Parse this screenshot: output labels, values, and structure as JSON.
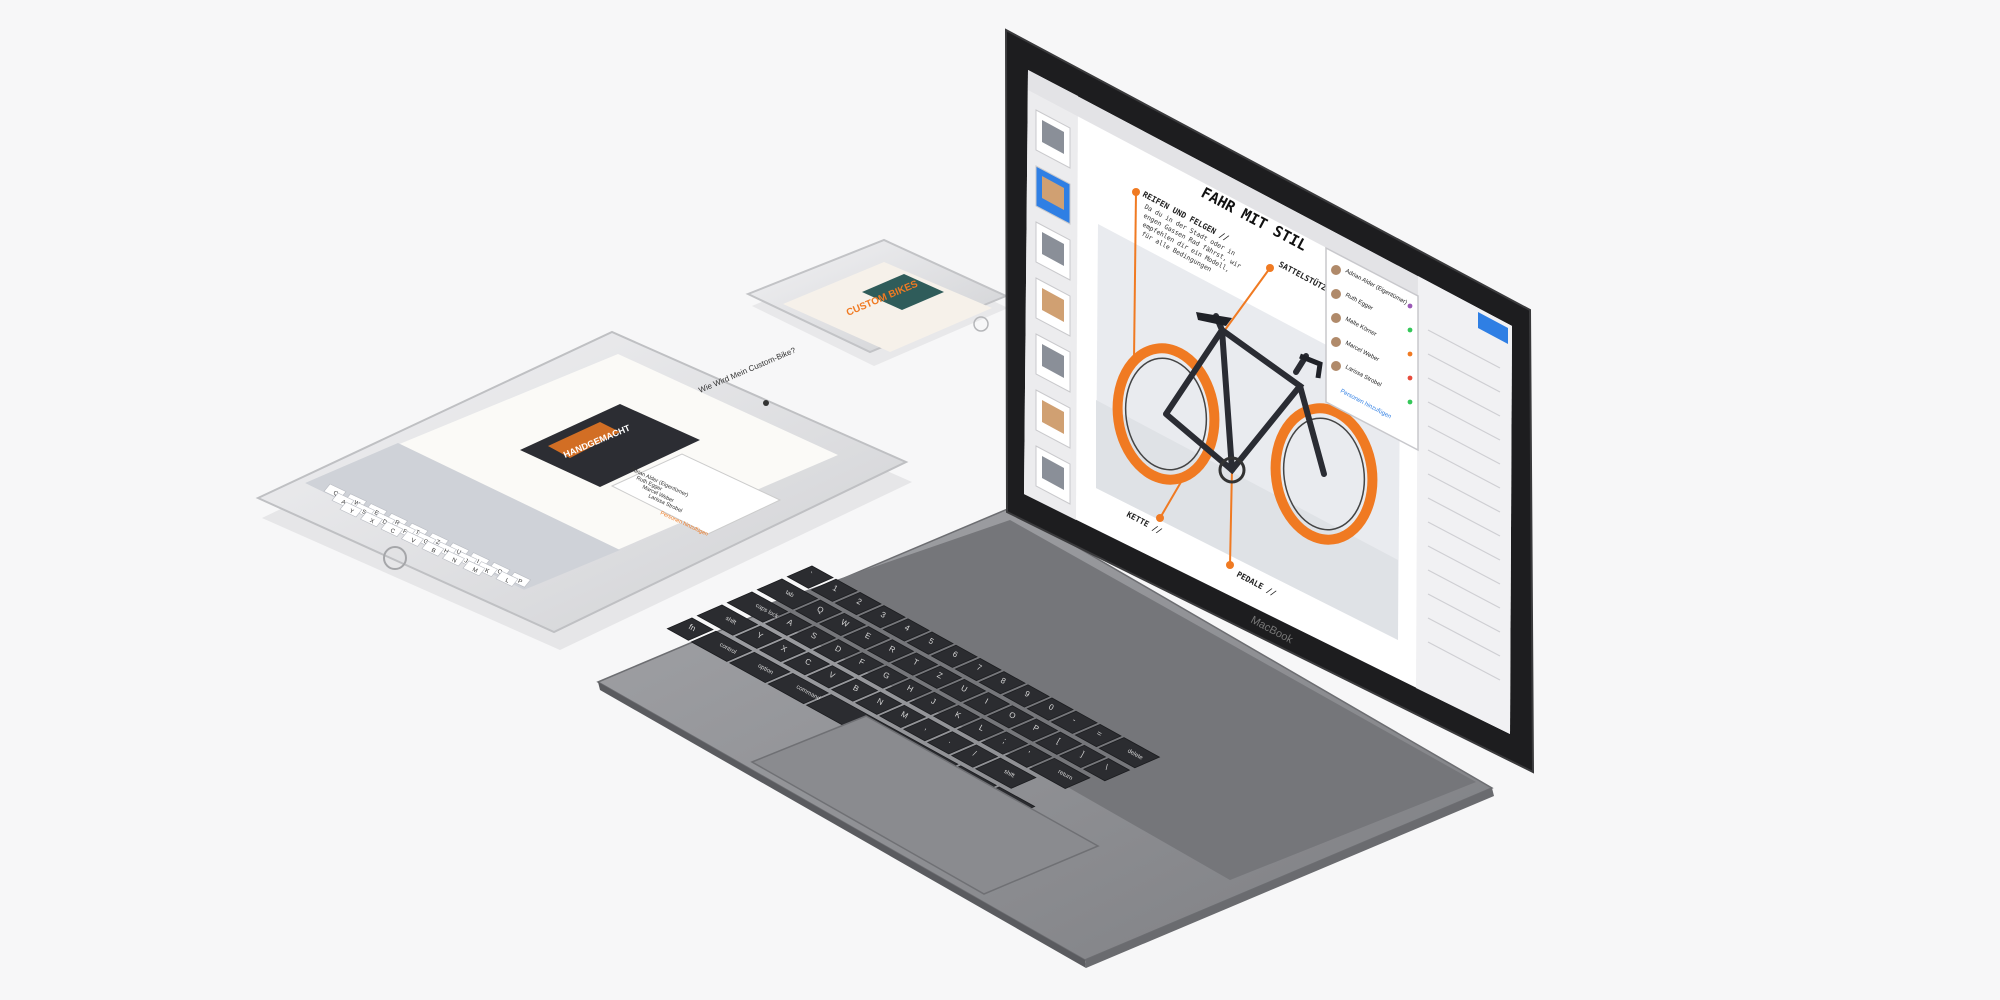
{
  "colors": {
    "background": "#f7f7f8",
    "accent_orange": "#f07a22",
    "macbook_body": "#8e8f93",
    "key_dark": "#2b2c30",
    "bezel": "#1a1a1c",
    "device_silver": "#e4e5e8",
    "collab_green": "#35c759",
    "selection_blue": "#2f7fe4"
  },
  "macbook": {
    "brand": "MacBook",
    "doc": {
      "title": "FAHR MIT STIL",
      "callouts": {
        "tires": "REIFEN UND FELGEN //",
        "saddle": "SATTELSTÜTZE",
        "chain": "KETTE //",
        "pedals": "PEDALE //"
      },
      "body_lines": [
        "Da du in der Stadt oder in",
        "engen Gassen Rad fährst, wir",
        "empfehlen dir ein Modell,",
        "für alle Bedingungen"
      ]
    },
    "collab_popover": {
      "items": [
        "Adrian Alder (Eigentümer)",
        "Ruth Egger",
        "Malte Körner",
        "Marcel Weber",
        "Larissa Strobel"
      ],
      "add_label": "Personen hinzufügen"
    },
    "keyboard": {
      "row1": [
        "`",
        "1",
        "2",
        "3",
        "4",
        "5",
        "6",
        "7",
        "8",
        "9",
        "0",
        "-",
        "=",
        "delete"
      ],
      "row2": [
        "tab",
        "Q",
        "W",
        "E",
        "R",
        "T",
        "Z",
        "U",
        "I",
        "O",
        "P",
        "[",
        "]",
        "\\"
      ],
      "row3": [
        "caps lock",
        "A",
        "S",
        "D",
        "F",
        "G",
        "H",
        "J",
        "K",
        "L",
        ";",
        "'",
        "return"
      ],
      "row4": [
        "shift",
        "Y",
        "X",
        "C",
        "V",
        "B",
        "N",
        "M",
        ",",
        ".",
        "/",
        "shift"
      ],
      "row5": [
        "fn",
        "control",
        "option",
        "command",
        "",
        "command",
        "option"
      ]
    }
  },
  "ipad": {
    "doc_heading": "Wie Wird Mein Custom-Bike?",
    "poster_text": "HANDGEMACHT",
    "popover_items": [
      "Adrian Alder (Eigentümer)",
      "Ruth Egger",
      "Marcel Weber",
      "Larissa Strobel"
    ],
    "popover_add": "Personen hinzufügen",
    "keyboard": [
      "Q",
      "W",
      "E",
      "R",
      "T",
      "Z",
      "U",
      "I",
      "O",
      "P",
      "A",
      "S",
      "D",
      "F",
      "G",
      "H",
      "J",
      "K",
      "L",
      "Y",
      "X",
      "C",
      "V",
      "B",
      "N",
      "M"
    ]
  },
  "iphone": {
    "poster_text": "CUSTOM BIKES"
  }
}
